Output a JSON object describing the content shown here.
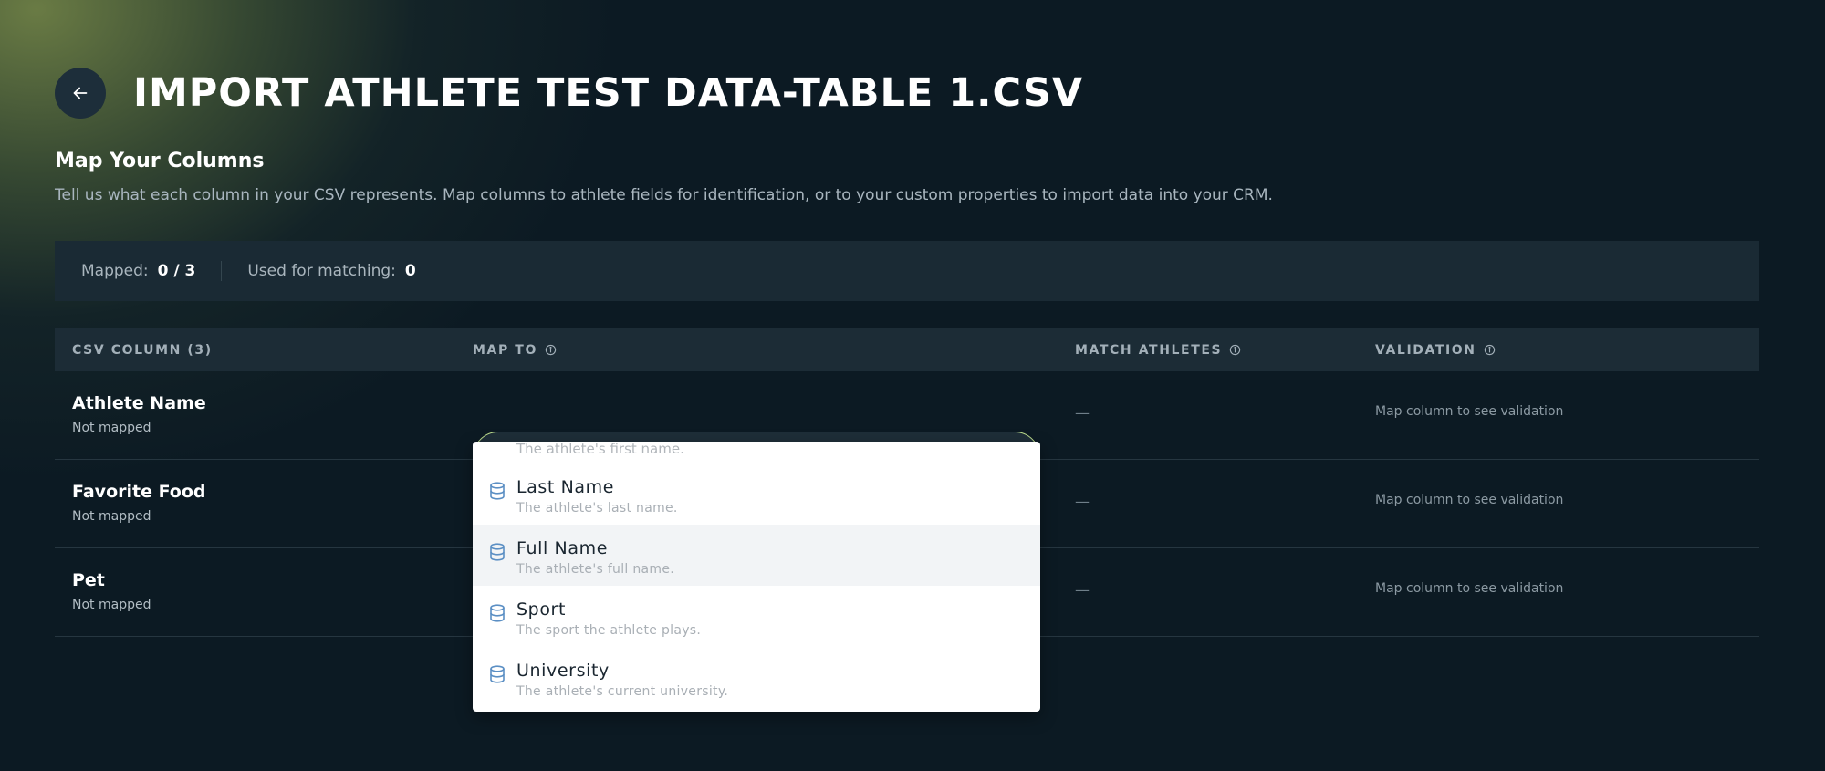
{
  "header": {
    "title": "IMPORT ATHLETE TEST DATA-TABLE 1.CSV"
  },
  "section": {
    "title": "Map Your Columns",
    "description": "Tell us what each column in your CSV represents. Map columns to athlete fields for identification, or to your custom properties to import data into your CRM."
  },
  "stats": {
    "mapped_label": "Mapped:",
    "mapped_value": "0 / 3",
    "matching_label": "Used for matching:",
    "matching_value": "0"
  },
  "table": {
    "headers": {
      "csv_column": "CSV COLUMN (3)",
      "map_to": "MAP TO",
      "match_athletes": "MATCH ATHLETES",
      "validation": "VALIDATION"
    },
    "rows": [
      {
        "name": "Athlete Name",
        "status": "Not mapped",
        "match": "—",
        "validation": "Map column to see validation"
      },
      {
        "name": "Favorite Food",
        "status": "Not mapped",
        "match": "—",
        "validation": "Map column to see validation"
      },
      {
        "name": "Pet",
        "status": "Not mapped",
        "match": "—",
        "validation": "Map column to see validation"
      }
    ]
  },
  "dropdown": {
    "partial_desc": "The athlete's first name.",
    "items": [
      {
        "label": "Last Name",
        "desc": "The athlete's last name.",
        "icon": "database-icon"
      },
      {
        "label": "Full Name",
        "desc": "The athlete's full name.",
        "icon": "database-icon",
        "highlighted": true
      },
      {
        "label": "Sport",
        "desc": "The sport the athlete plays.",
        "icon": "database-icon"
      },
      {
        "label": "University",
        "desc": "The athlete's current university.",
        "icon": "database-icon"
      }
    ]
  },
  "colors": {
    "background": "#0c1a23",
    "accent_green": "#b9d98b",
    "icon_blue": "#5b8fc4"
  }
}
